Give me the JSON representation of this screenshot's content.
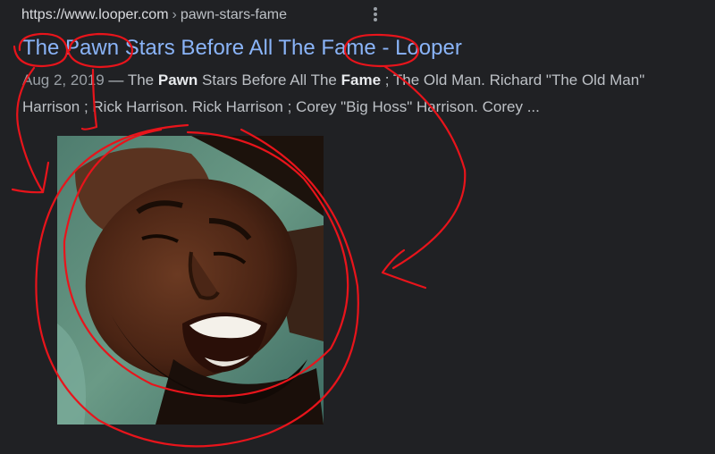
{
  "result": {
    "url_domain": "https://www.looper.com",
    "url_sep": "›",
    "url_path": "pawn-stars-fame",
    "more_icon": "vertical-dots-icon",
    "title": {
      "w1": "The",
      "w2": "Pawn",
      "w3": "Stars Before All The",
      "w4": "Fame",
      "w5": "- Looper"
    },
    "snippet": {
      "date": "Aug 2, 2019",
      "dash": " — ",
      "t1": "The ",
      "b1": "Pawn",
      "t2": " Stars Before All The ",
      "b2": "Fame",
      "t3": " ; The Old Man. Richard \"The Old Man\" Harrison ; Rick Harrison. Rick Harrison ; Corey \"Big Hoss\" Harrison. Corey ..."
    },
    "thumbnail_icon": "laughing-man-photo"
  },
  "colors": {
    "background": "#202124",
    "link": "#8ab4f8",
    "annotation": "#e8141b"
  }
}
